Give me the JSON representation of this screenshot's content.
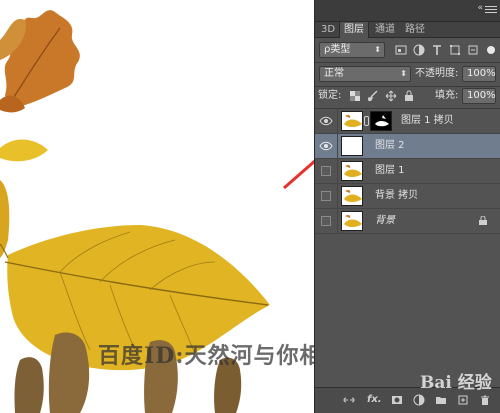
{
  "panel": {
    "tabs": [
      {
        "label": "3D"
      },
      {
        "label": "图层"
      },
      {
        "label": "通道"
      },
      {
        "label": "路径"
      }
    ],
    "filter": {
      "label": "ρ类型"
    },
    "blend_mode": {
      "value": "正常"
    },
    "opacity": {
      "label": "不透明度:",
      "value": "100%"
    },
    "lock": {
      "label": "锁定:"
    },
    "fill": {
      "label": "填充:",
      "value": "100%"
    },
    "layers": [
      {
        "name": "图层 1 拷贝",
        "visible": true,
        "selected": false
      },
      {
        "name": "图层 2",
        "visible": true,
        "selected": true
      },
      {
        "name": "图层 1",
        "visible": false,
        "selected": false
      },
      {
        "name": "背景 拷贝",
        "visible": false,
        "selected": false
      },
      {
        "name": "背景",
        "visible": false,
        "selected": false,
        "locked": true
      }
    ],
    "bottom": {
      "fx_label": "fx."
    }
  },
  "canvas": {
    "watermark": "百度ID:天然河与你相约",
    "watermark_brand": "Bai 经验"
  },
  "colors": {
    "panel_bg": "#535353",
    "selected_layer": "#6f7d8f",
    "annotation_arrow": "#e8312a"
  }
}
